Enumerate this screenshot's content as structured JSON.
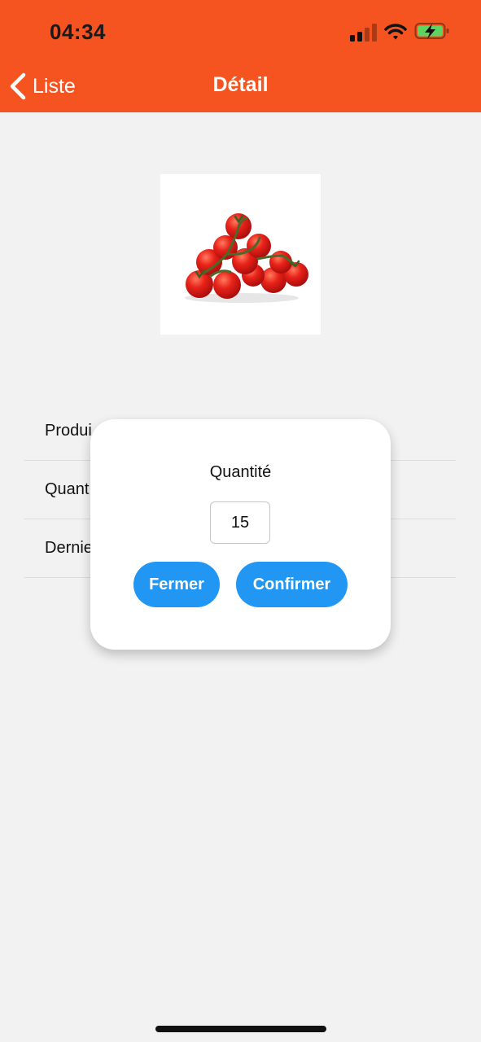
{
  "status_bar": {
    "time": "04:34",
    "signal_icon": "cellular-signal-icon",
    "wifi_icon": "wifi-icon",
    "battery_icon": "battery-charging-icon",
    "battery_color": "#5fd35f"
  },
  "nav": {
    "back_label": "Liste",
    "back_icon": "chevron-left-icon",
    "title": "Détail",
    "background_color": "#f55420"
  },
  "product": {
    "image_icon": "cherry-tomatoes-image"
  },
  "details": {
    "rows": [
      {
        "label": "Produi"
      },
      {
        "label": "Quant"
      },
      {
        "label": "Dernie"
      }
    ]
  },
  "modal": {
    "title": "Quantité",
    "quantity_value": "15",
    "close_label": "Fermer",
    "confirm_label": "Confirmer",
    "button_color": "#2196f3"
  }
}
